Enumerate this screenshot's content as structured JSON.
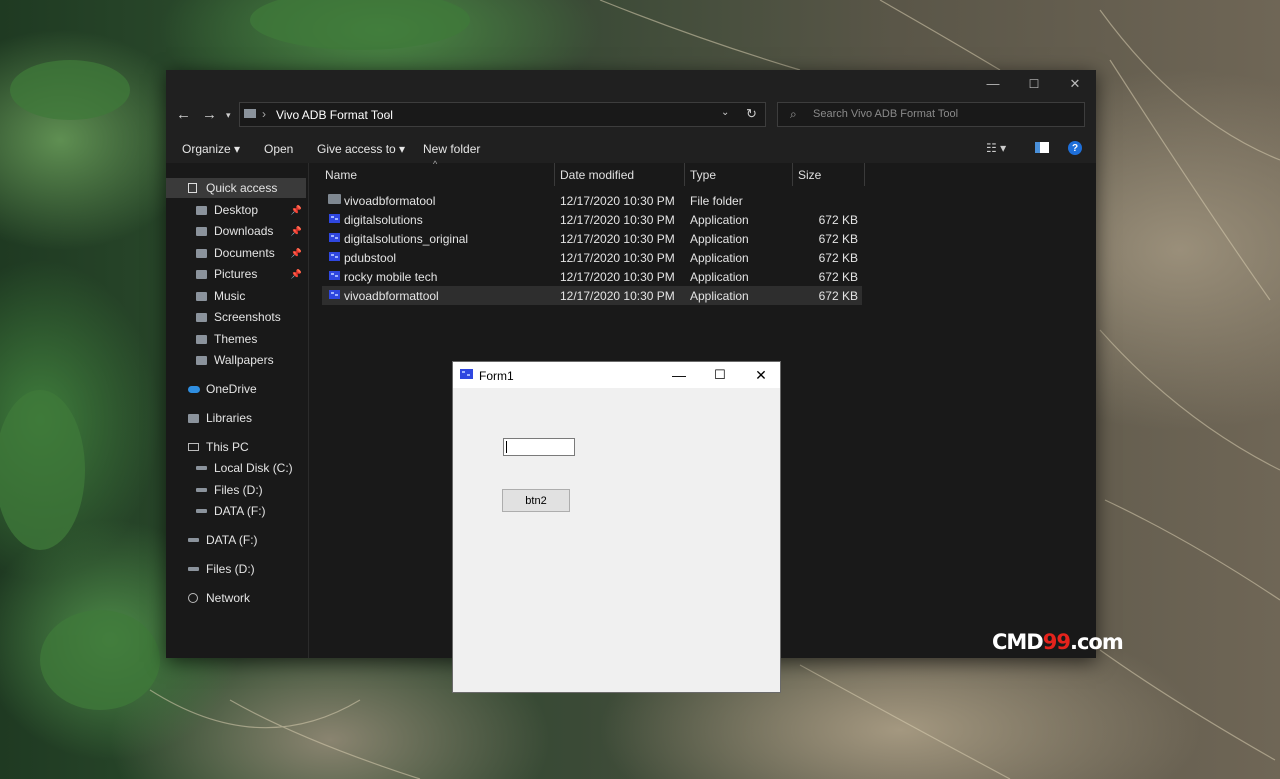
{
  "desktop": {
    "watermark_a": "CMD",
    "watermark_b": "99",
    "watermark_c": ".com"
  },
  "explorer": {
    "window_controls": {
      "minimize": "—",
      "maximize": "☐",
      "close": "✕"
    },
    "address": {
      "path": "Vivo ADB Format Tool",
      "sep": "›"
    },
    "search": {
      "placeholder": "Search Vivo ADB Format Tool"
    },
    "commands": {
      "organize": "Organize ▾",
      "open": "Open",
      "give_access": "Give access to ▾",
      "new_folder": "New folder"
    },
    "sidebar": [
      {
        "label": "Quick access",
        "pinned": false
      },
      {
        "label": "Desktop",
        "pinned": true
      },
      {
        "label": "Downloads",
        "pinned": true
      },
      {
        "label": "Documents",
        "pinned": true
      },
      {
        "label": "Pictures",
        "pinned": true
      },
      {
        "label": "Music",
        "pinned": false
      },
      {
        "label": "Screenshots",
        "pinned": false
      },
      {
        "label": "Themes",
        "pinned": false
      },
      {
        "label": "Wallpapers",
        "pinned": false
      },
      {
        "label": "OneDrive",
        "pinned": false
      },
      {
        "label": "Libraries",
        "pinned": false
      },
      {
        "label": "This PC",
        "pinned": false
      },
      {
        "label": "Local Disk (C:)",
        "pinned": false
      },
      {
        "label": "Files (D:)",
        "pinned": false
      },
      {
        "label": "DATA (F:)",
        "pinned": false
      },
      {
        "label": "DATA (F:)",
        "pinned": false
      },
      {
        "label": "Files (D:)",
        "pinned": false
      },
      {
        "label": "Network",
        "pinned": false
      }
    ],
    "columns": {
      "name": "Name",
      "date": "Date modified",
      "type": "Type",
      "size": "Size"
    },
    "files": [
      {
        "name": "vivoadbformatool",
        "date": "12/17/2020 10:30 PM",
        "type": "File folder",
        "size": ""
      },
      {
        "name": "digitalsolutions",
        "date": "12/17/2020 10:30 PM",
        "type": "Application",
        "size": "672 KB"
      },
      {
        "name": "digitalsolutions_original",
        "date": "12/17/2020 10:30 PM",
        "type": "Application",
        "size": "672 KB"
      },
      {
        "name": "pdubstool",
        "date": "12/17/2020 10:30 PM",
        "type": "Application",
        "size": "672 KB"
      },
      {
        "name": "rocky mobile tech",
        "date": "12/17/2020 10:30 PM",
        "type": "Application",
        "size": "672 KB"
      },
      {
        "name": "vivoadbformattool",
        "date": "12/17/2020 10:30 PM",
        "type": "Application",
        "size": "672 KB"
      }
    ]
  },
  "form1": {
    "title": "Form1",
    "controls": {
      "minimize": "—",
      "maximize": "☐",
      "close": "✕"
    },
    "textbox_value": "",
    "button_label": "btn2"
  }
}
